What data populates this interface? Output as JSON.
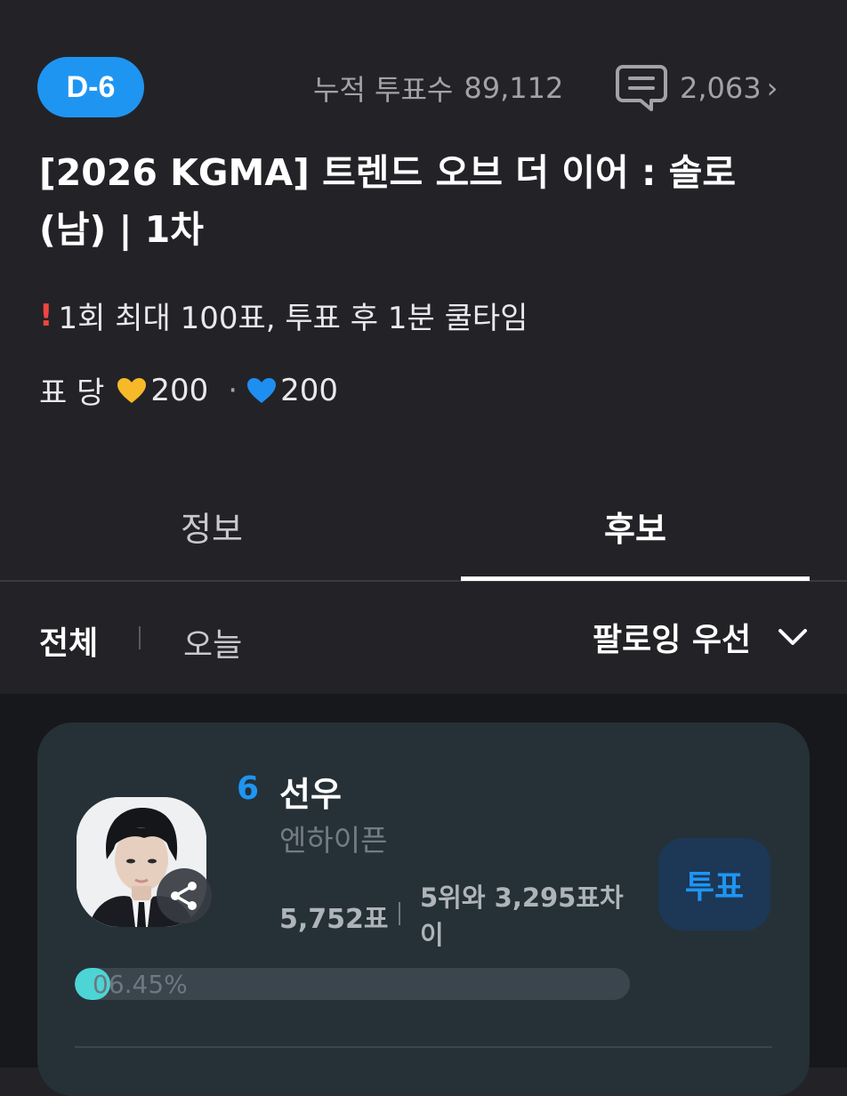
{
  "header": {
    "dday_badge": "D-6",
    "total_votes_label": "누적 투표수",
    "total_votes_value": "89,112",
    "comment_icon": "chat-bubble-icon",
    "comment_count": "2,063",
    "chevron": "›"
  },
  "title": {
    "line1": "[2026 KGMA] 트렌드 오브 더 이어 : 솔로",
    "line2": "(남) | 1차"
  },
  "notice": {
    "mark": "!",
    "text": "1회 최대 100표, 투표 후 1분 쿨타임"
  },
  "cost": {
    "label": "표 당",
    "gold_heart_amount": "200",
    "separator": "·",
    "blue_heart_amount": "200",
    "gold_color": "#f7b928",
    "blue_color": "#1f8ef1"
  },
  "tabs": [
    {
      "label": "정보",
      "active": false
    },
    {
      "label": "후보",
      "active": true
    }
  ],
  "filters": {
    "all": "전체",
    "today": "오늘",
    "sort": "팔로잉 우선"
  },
  "candidate": {
    "rank": "6",
    "name": "선우",
    "group": "엔하이픈",
    "votes": "5,752표",
    "gap_line1": "5위와 3,295표차",
    "gap_line2": "이",
    "vote_button": "투표",
    "percent_label": "06.45%",
    "percent_value": 6.45
  },
  "colors": {
    "accent": "#1f95f2",
    "background": "#232327",
    "card": "#253137",
    "progress_fill": "#4dd4d4"
  }
}
